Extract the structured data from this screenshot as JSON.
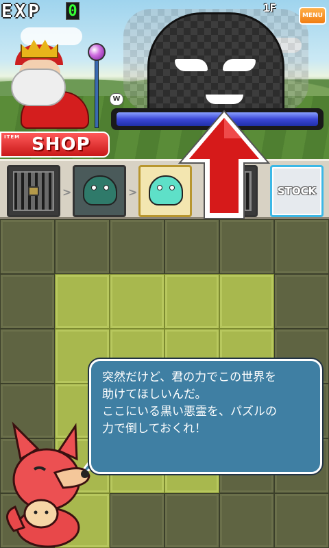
{
  "hud": {
    "exp_label": "EXP",
    "exp_value": "0",
    "floor": "1F",
    "menu_label": "MENU"
  },
  "shop": {
    "item_label": "ITEM",
    "label": "SHOP"
  },
  "enemy": {
    "hp_fraction": 1.0
  },
  "item_strip": {
    "slots": [
      "locked-cage",
      "dark-slime",
      "cyan-slime",
      "locked-cage"
    ],
    "stock_label": "STOCK"
  },
  "board": {
    "rows": 6,
    "cols": 6,
    "lit_tiles": [
      [
        1,
        1
      ],
      [
        1,
        2
      ],
      [
        1,
        3
      ],
      [
        1,
        4
      ],
      [
        2,
        1
      ],
      [
        2,
        2
      ],
      [
        2,
        3
      ],
      [
        2,
        4
      ],
      [
        3,
        1
      ],
      [
        3,
        2
      ],
      [
        3,
        3
      ],
      [
        3,
        4
      ],
      [
        4,
        1
      ],
      [
        4,
        2
      ],
      [
        4,
        3
      ],
      [
        5,
        1
      ]
    ]
  },
  "dialogue": {
    "text": "突然だけど、君の力でこの世界を\n助けてほしいんだ。\nここにいる黒い悪霊を、パズルの\n力で倒しておくれ！"
  },
  "colors": {
    "hp_bar": "#3b47d6",
    "shop_button": "#d41e1e",
    "speech_bubble": "#3f7fa3",
    "arrow": "#d61a1a",
    "lit_tile": "#a8b84e",
    "dark_tile": "#5f6442"
  }
}
